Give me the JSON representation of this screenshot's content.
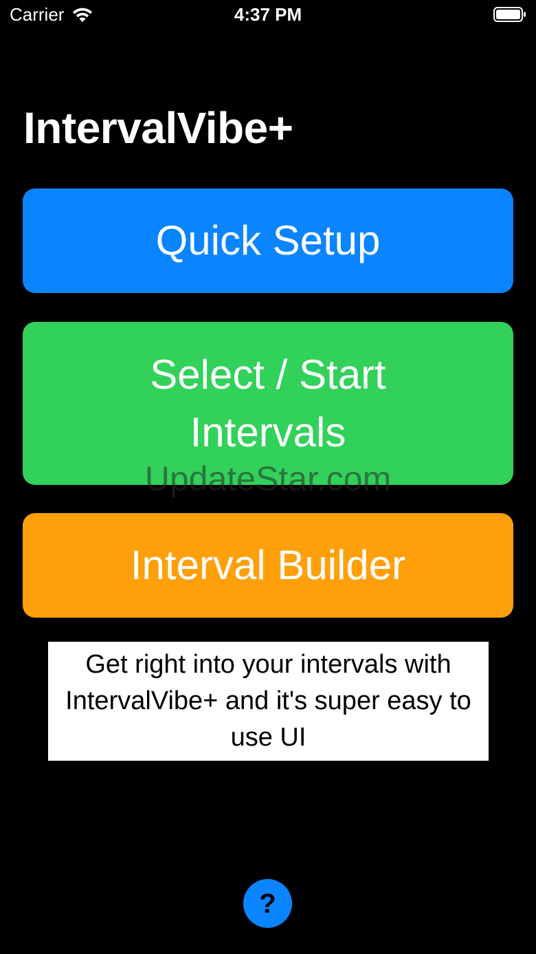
{
  "status_bar": {
    "carrier": "Carrier",
    "time": "4:37 PM",
    "wifi_icon": "wifi-icon",
    "battery_icon": "battery-icon"
  },
  "header": {
    "title": "IntervalVibe+"
  },
  "buttons": {
    "quick_setup": {
      "label": "Quick Setup",
      "color": "#0a84ff"
    },
    "select_start_intervals": {
      "label": "Select / Start Intervals",
      "color": "#32d15a"
    },
    "interval_builder": {
      "label": "Interval Builder",
      "color": "#ff9f0a"
    }
  },
  "description": {
    "text": "Get right into your intervals with IntervalVibe+ and it's super easy to use UI"
  },
  "help": {
    "label": "?",
    "icon": "question-mark-icon",
    "color": "#0a84ff"
  },
  "watermark": "UpdateStar.com"
}
